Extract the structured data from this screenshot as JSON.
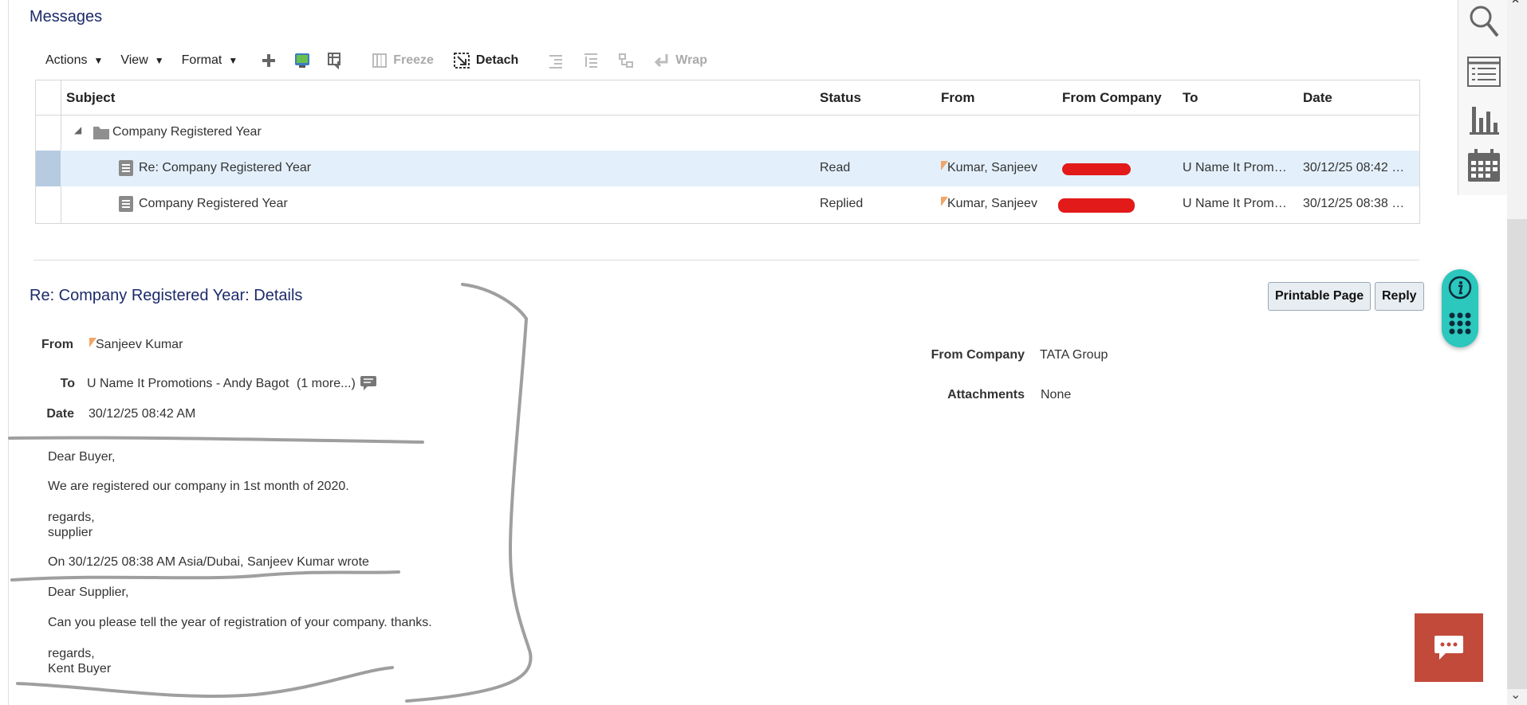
{
  "messages": {
    "title": "Messages"
  },
  "toolbar": {
    "menus": [
      "Actions",
      "View",
      "Format"
    ],
    "freeze": "Freeze",
    "detach": "Detach",
    "wrap": "Wrap"
  },
  "table": {
    "headers": {
      "subject": "Subject",
      "status": "Status",
      "from": "From",
      "from_company": "From Company",
      "to": "To",
      "date": "Date"
    },
    "folder": "Company Registered Year",
    "rows": [
      {
        "subject": "Re: Company Registered Year",
        "status": "Read",
        "from": "Kumar, Sanjeev",
        "to": "U Name It Prom…",
        "date": "30/12/25 08:42 …",
        "selected": true
      },
      {
        "subject": "Company Registered Year",
        "status": "Replied",
        "from": "Kumar, Sanjeev",
        "to": "U Name It Prom…",
        "date": "30/12/25 08:38 …",
        "selected": false
      }
    ]
  },
  "details": {
    "title": "Re: Company Registered Year: Details",
    "printable_page": "Printable Page",
    "reply": "Reply",
    "from_label": "From",
    "from_value": "Sanjeev Kumar",
    "to_label": "To",
    "to_value": "U Name It Promotions - Andy Bagot",
    "to_more": "(1 more...)",
    "date_label": "Date",
    "date_value": "30/12/25 08:42 AM",
    "from_company_label": "From Company",
    "from_company_value": "TATA Group",
    "attachments_label": "Attachments",
    "attachments_value": "None"
  },
  "body": {
    "lines": [
      "Dear Buyer,",
      "We are registered our company in 1st month of 2020.",
      "regards,",
      "supplier",
      "On 30/12/25 08:38 AM Asia/Dubai, Sanjeev Kumar wrote",
      "Dear Supplier,",
      "Can you please tell the year of registration of your company. thanks.",
      "regards,",
      "Kent Buyer"
    ]
  },
  "colors": {
    "title": "#1c2a6b",
    "selected_row": "#e3f0fb",
    "fab": "#2cc7bd",
    "chat": "#c24a3b",
    "redaction": "#e21a1a"
  },
  "icons": [
    "search-icon",
    "list-icon",
    "bar-chart-icon",
    "calendar-icon",
    "info-icon",
    "apps-grid-icon",
    "chat-icon"
  ]
}
